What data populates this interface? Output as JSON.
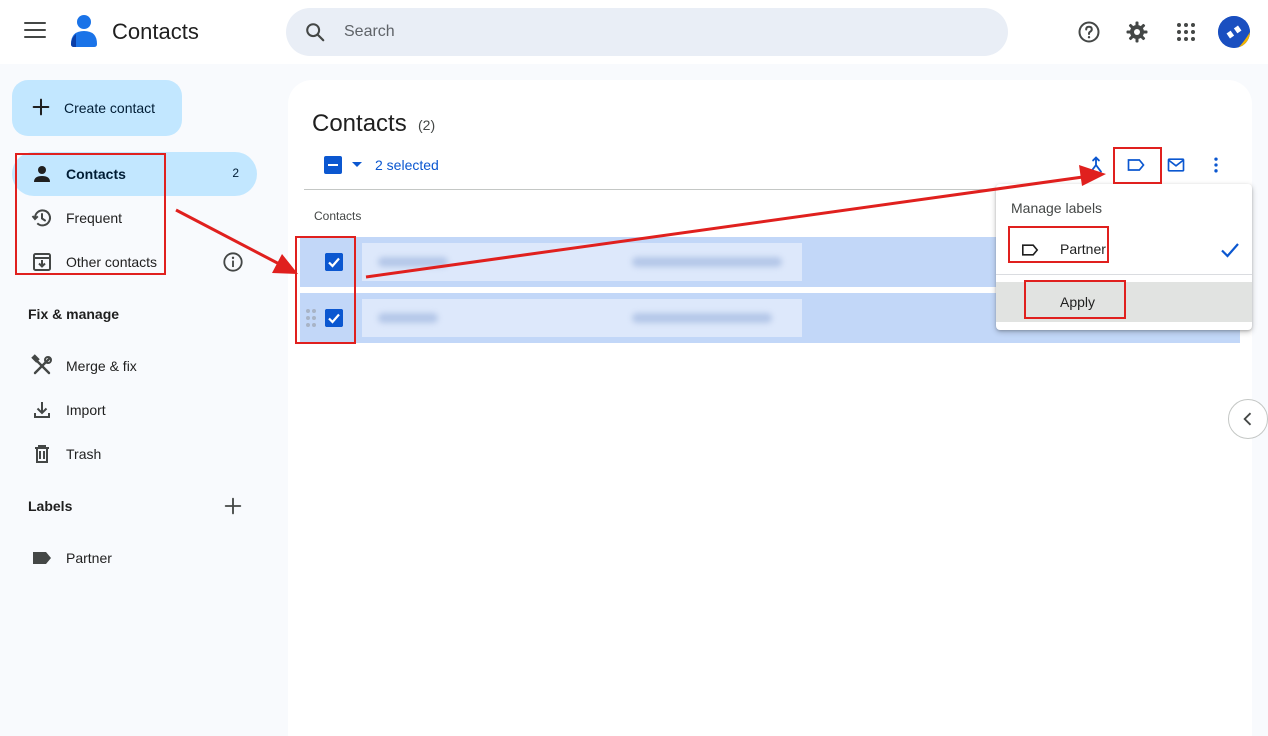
{
  "header": {
    "app_title": "Contacts",
    "search_placeholder": "Search"
  },
  "sidebar": {
    "create_label": "Create contact",
    "items": [
      {
        "label": "Contacts",
        "count": "2"
      },
      {
        "label": "Frequent"
      },
      {
        "label": "Other contacts"
      }
    ],
    "fix_manage_title": "Fix & manage",
    "fix_items": [
      {
        "label": "Merge & fix"
      },
      {
        "label": "Import"
      },
      {
        "label": "Trash"
      }
    ],
    "labels_title": "Labels",
    "labels": [
      {
        "label": "Partner"
      }
    ]
  },
  "main": {
    "title": "Contacts",
    "count": "(2)",
    "selected_text": "2 selected",
    "column_header": "Contacts",
    "row_count": 2
  },
  "label_menu": {
    "heading": "Manage labels",
    "item_label": "Partner",
    "item_checked": true,
    "apply_label": "Apply"
  },
  "colors": {
    "accent": "#0b57d0",
    "active_nav": "#c2e7ff",
    "selected_row": "#c2d7f8",
    "annotation": "#e0201e"
  }
}
